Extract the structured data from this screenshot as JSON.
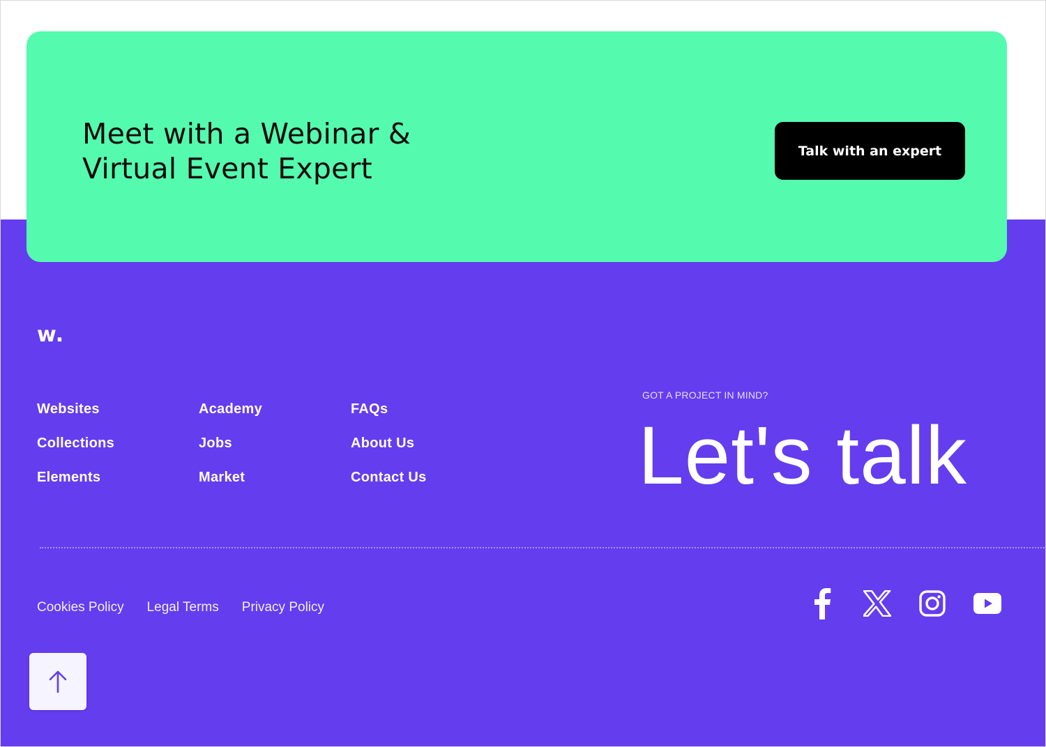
{
  "cta": {
    "heading": "Meet with a Webinar & Virtual Event Expert",
    "button_label": "Talk with an expert"
  },
  "footer": {
    "logo": "w.",
    "nav_columns": [
      [
        "Websites",
        "Collections",
        "Elements"
      ],
      [
        "Academy",
        "Jobs",
        "Market"
      ],
      [
        "FAQs",
        "About Us",
        "Contact Us"
      ]
    ],
    "project_label": "GOT A PROJECT IN MIND?",
    "lets_talk": "Let's talk",
    "legal_links": [
      "Cookies Policy",
      "Legal Terms",
      "Privacy Policy"
    ],
    "socials": [
      "facebook-icon",
      "x-icon",
      "instagram-icon",
      "youtube-icon"
    ]
  },
  "colors": {
    "banner": "#54fbae",
    "footer_bg": "#643dee",
    "button_bg": "#000000",
    "scroll_top_arrow": "#643dee"
  },
  "icons": {
    "scroll_top": "arrow-up-icon"
  }
}
